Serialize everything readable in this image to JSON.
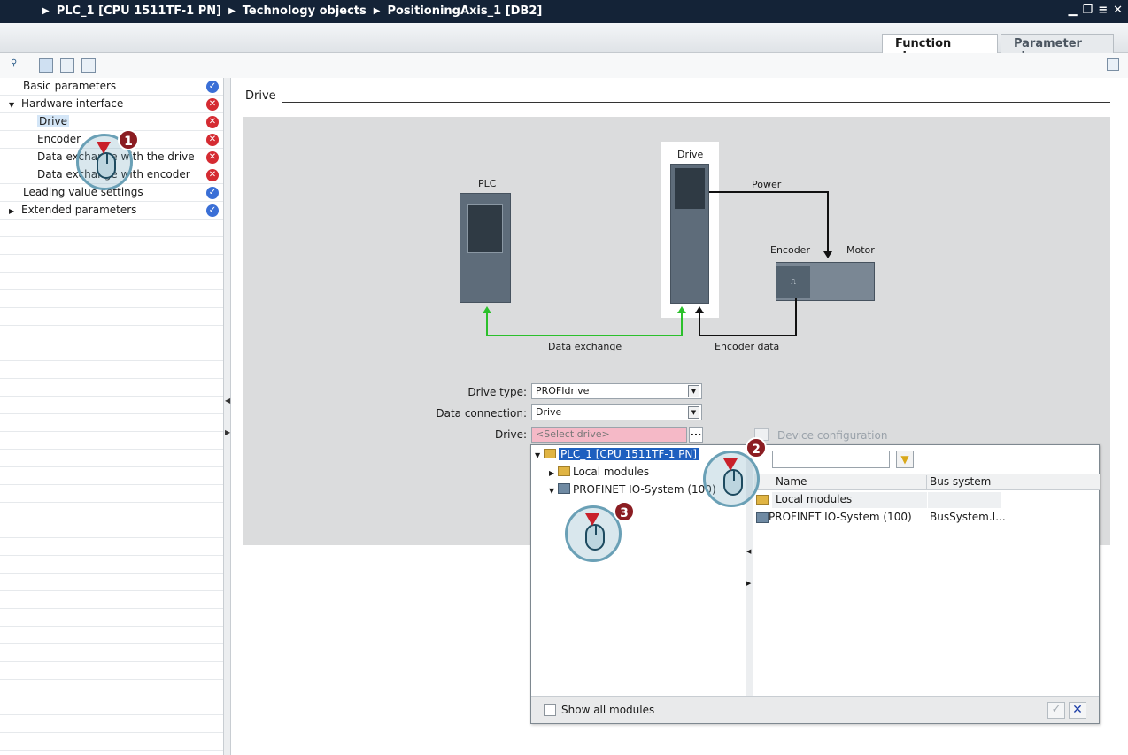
{
  "titlebar": {
    "crumbs": [
      "PLC_1 [CPU 1511TF-1 PN]",
      "Technology objects",
      "PositioningAxis_1 [DB2]"
    ]
  },
  "tabs": {
    "function_view": "Function view",
    "parameter_view": "Parameter view"
  },
  "nav": {
    "items": [
      {
        "label": "Basic parameters",
        "status": "ok"
      },
      {
        "label": "Hardware interface",
        "status": "error"
      },
      {
        "label": "Drive",
        "status": "error"
      },
      {
        "label": "Encoder",
        "status": "error"
      },
      {
        "label": "Data exchange with the drive",
        "status": "error"
      },
      {
        "label": "Data exchange with encoder",
        "status": "error"
      },
      {
        "label": "Leading value settings",
        "status": "ok"
      },
      {
        "label": "Extended parameters",
        "status": "ok"
      }
    ]
  },
  "section": {
    "title": "Drive"
  },
  "diagram": {
    "plc": "PLC",
    "drive": "Drive",
    "power": "Power",
    "encoder": "Encoder",
    "motor": "Motor",
    "data_exchange": "Data exchange",
    "encoder_data": "Encoder data"
  },
  "form": {
    "drive_type_label": "Drive type:",
    "drive_type_value": "PROFIdrive",
    "data_connection_label": "Data connection:",
    "data_connection_value": "Drive",
    "drive_label": "Drive:",
    "drive_placeholder": "<Select drive>",
    "browse_button": "...",
    "device_configuration": "Device configuration"
  },
  "popup": {
    "tree": {
      "root": "PLC_1 [CPU 1511TF-1 PN]",
      "local_modules": "Local modules",
      "profinet": "PROFINET IO-System (100)"
    },
    "grid": {
      "col_name": "Name",
      "col_bus": "Bus system",
      "rows": [
        {
          "name": "Local modules",
          "bus": ""
        },
        {
          "name": "PROFINET IO-System (100)",
          "bus": "BusSystem.I..."
        }
      ]
    },
    "show_all_modules": "Show all modules"
  },
  "callouts": {
    "one": "1",
    "two": "2",
    "three": "3"
  },
  "colors": {
    "titlebar": "#142337",
    "ok": "#3a6fd6",
    "error": "#d52b32",
    "arrow_green": "#2bc02b",
    "select_invalid": "#f5b9c7"
  }
}
